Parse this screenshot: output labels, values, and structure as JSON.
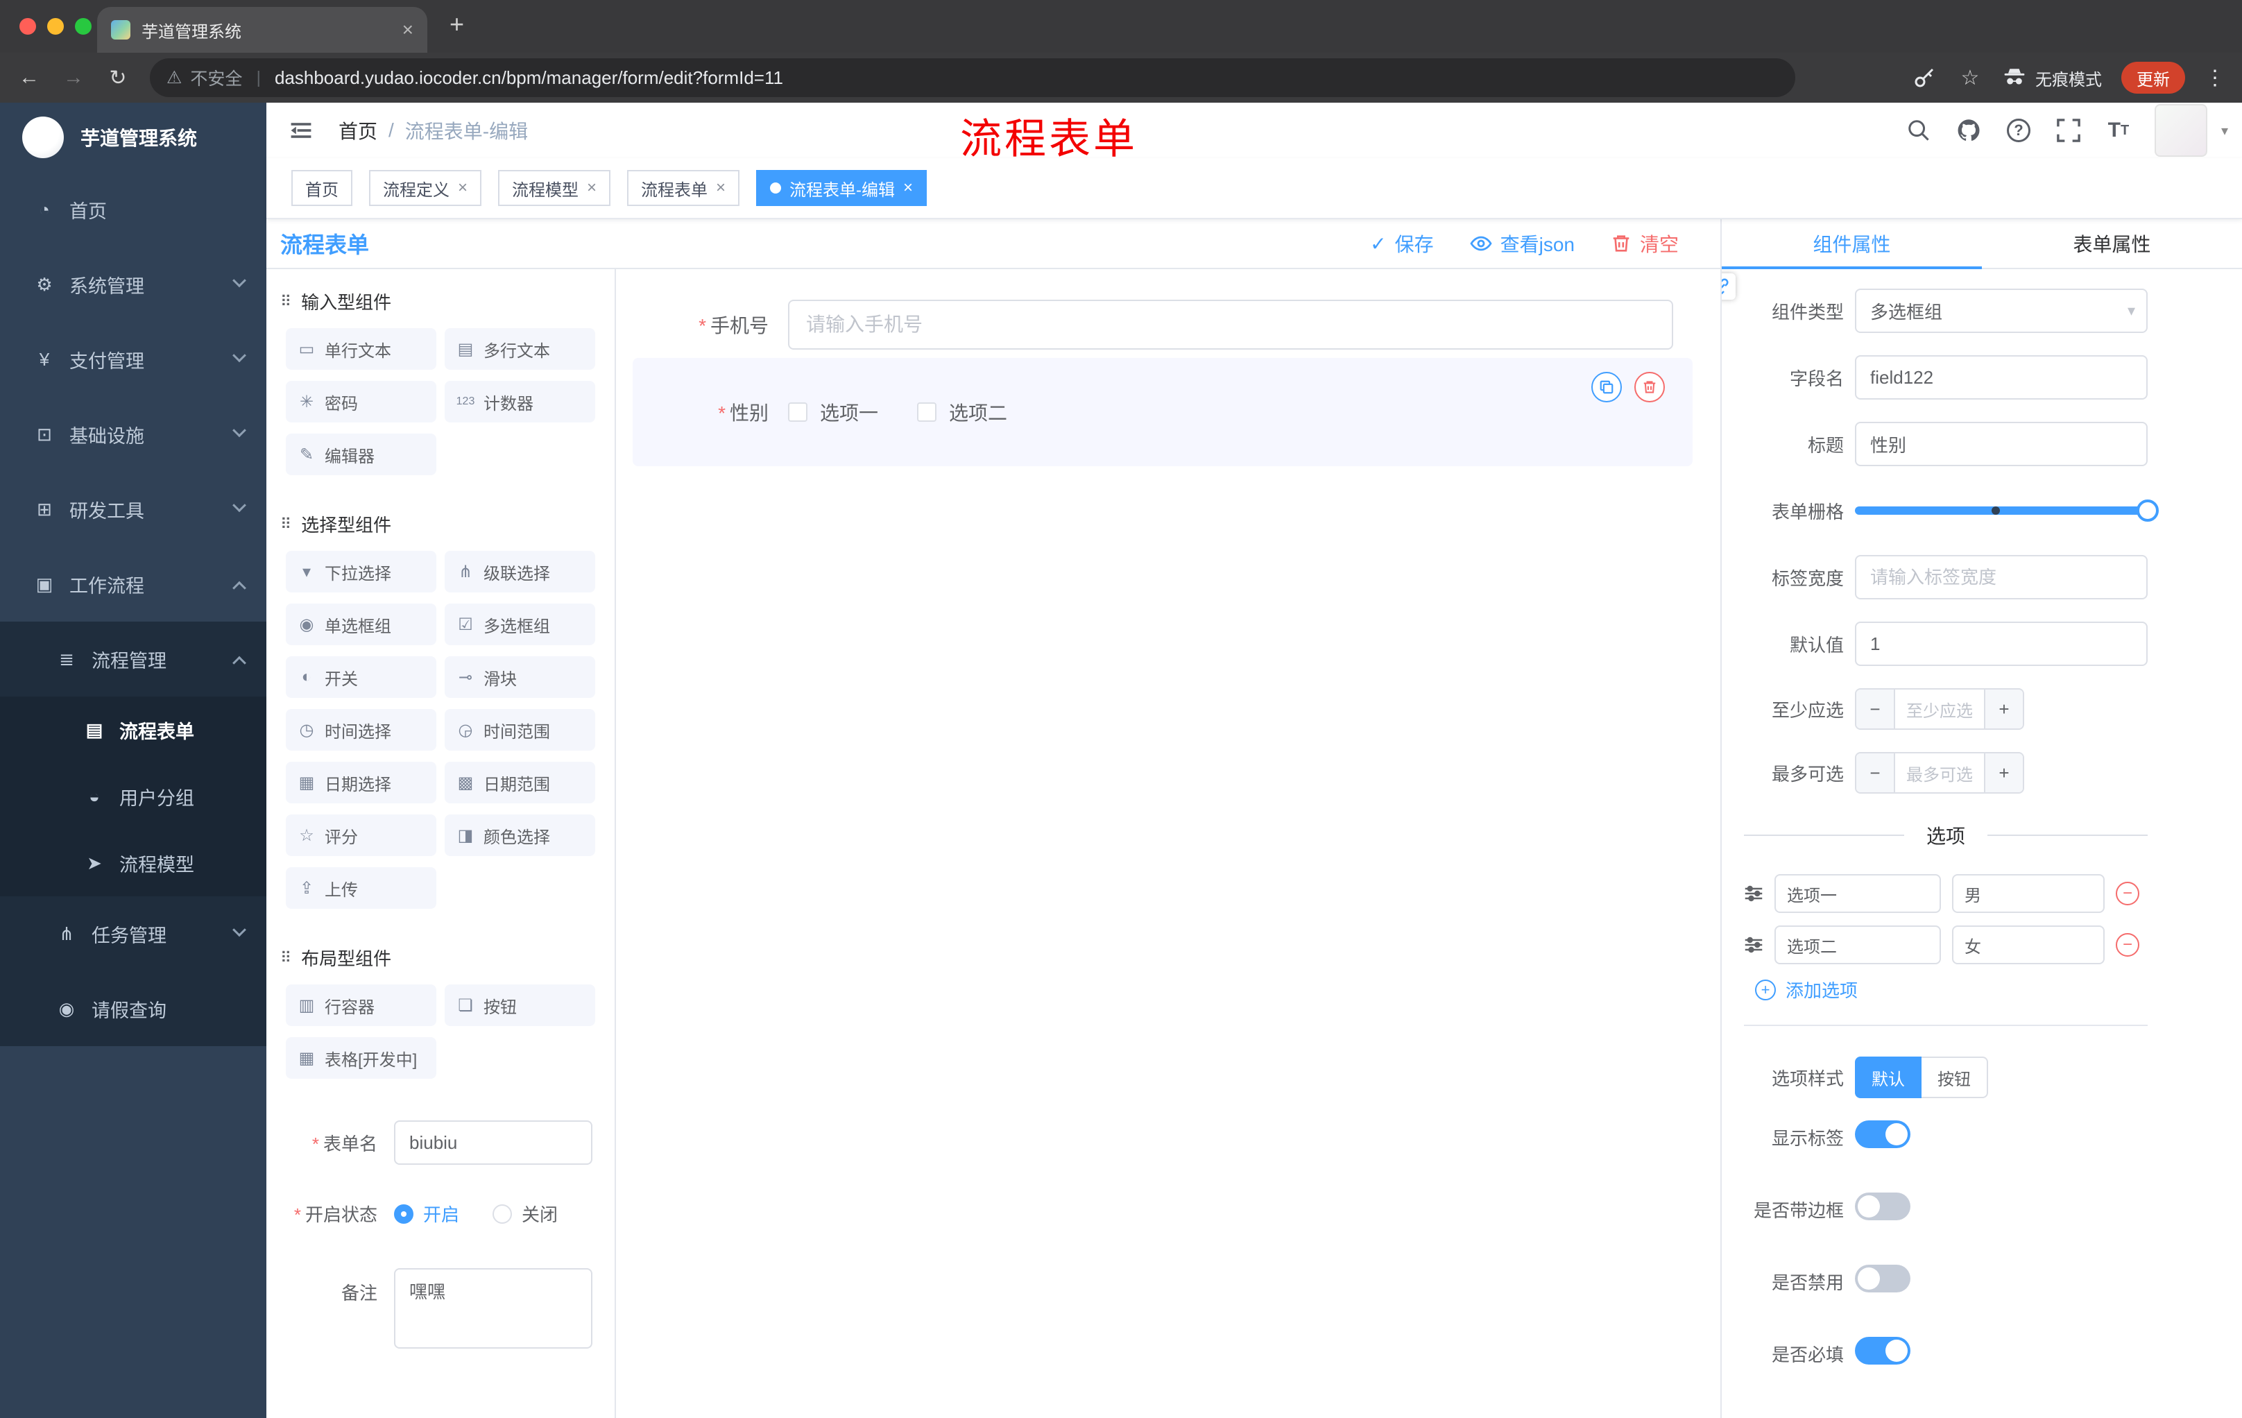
{
  "colors": {
    "accent": "#409eff",
    "danger": "#f56c6c",
    "update_badge": "#d2422b",
    "sidebar": "#304156"
  },
  "icons": {
    "close": "×",
    "new_tab": "+",
    "back": "←",
    "forward": "→",
    "reload": "↻",
    "overflow": "⋮",
    "star": "☆",
    "warning": "⚠",
    "separator": "|",
    "minus": "−",
    "plus": "+",
    "caret_down": "▾",
    "check": "✓",
    "breadcrumb_sep": "/",
    "palette_section": "⠿",
    "tab_close": "×"
  },
  "browser": {
    "tab_title": "芋道管理系统",
    "security_label": "不安全",
    "url": "dashboard.yudao.iocoder.cn/bpm/manager/form/edit?formId=11",
    "incognito_label": "无痕模式",
    "update_label": "更新"
  },
  "sidebar": {
    "brand": "芋道管理系统",
    "items": [
      {
        "icon": "◔",
        "label": "首页"
      },
      {
        "icon": "⚙",
        "label": "系统管理"
      },
      {
        "icon": "¥",
        "label": "支付管理"
      },
      {
        "icon": "⊡",
        "label": "基础设施"
      },
      {
        "icon": "⊞",
        "label": "研发工具"
      },
      {
        "icon": "▣",
        "label": "工作流程"
      },
      {
        "icon": "≣",
        "label": "流程管理"
      },
      {
        "icon": "▤",
        "label": "流程表单"
      },
      {
        "icon": "◒",
        "label": "用户分组"
      },
      {
        "icon": "➤",
        "label": "流程模型"
      },
      {
        "icon": "⋔",
        "label": "任务管理"
      },
      {
        "icon": "◉",
        "label": "请假查询"
      }
    ]
  },
  "header": {
    "breadcrumb_home": "首页",
    "breadcrumb_current": "流程表单-编辑",
    "annotation": "流程表单"
  },
  "tags": [
    {
      "label": "首页"
    },
    {
      "label": "流程定义"
    },
    {
      "label": "流程模型"
    },
    {
      "label": "流程表单"
    },
    {
      "label": "流程表单-编辑"
    }
  ],
  "designer": {
    "title": "流程表单",
    "actions": {
      "save": "保存",
      "view_json": "查看json",
      "clear": "清空"
    },
    "palette": [
      {
        "section": "输入型组件",
        "items": [
          {
            "icon": "▭",
            "label": "单行文本"
          },
          {
            "icon": "▤",
            "label": "多行文本"
          },
          {
            "icon": "✳",
            "label": "密码"
          },
          {
            "icon": "123",
            "label": "计数器"
          },
          {
            "icon": "✎",
            "label": "编辑器"
          }
        ]
      },
      {
        "section": "选择型组件",
        "items": [
          {
            "icon": "▾",
            "label": "下拉选择"
          },
          {
            "icon": "⋔",
            "label": "级联选择"
          },
          {
            "icon": "◉",
            "label": "单选框组"
          },
          {
            "icon": "☑",
            "label": "多选框组"
          },
          {
            "icon": "◐",
            "label": "开关"
          },
          {
            "icon": "⊸",
            "label": "滑块"
          },
          {
            "icon": "◷",
            "label": "时间选择"
          },
          {
            "icon": "◶",
            "label": "时间范围"
          },
          {
            "icon": "▦",
            "label": "日期选择"
          },
          {
            "icon": "▩",
            "label": "日期范围"
          },
          {
            "icon": "☆",
            "label": "评分"
          },
          {
            "icon": "◨",
            "label": "颜色选择"
          },
          {
            "icon": "⇪",
            "label": "上传"
          }
        ]
      },
      {
        "section": "布局型组件",
        "items": [
          {
            "icon": "▥",
            "label": "行容器"
          },
          {
            "icon": "❏",
            "label": "按钮"
          },
          {
            "icon": "▦",
            "label": "表格[开发中]"
          }
        ]
      }
    ],
    "meta": {
      "form_name_label": "表单名",
      "form_name_value": "biubiu",
      "status_label": "开启状态",
      "status_on": "开启",
      "status_off": "关闭",
      "remark_label": "备注",
      "remark_value": "嘿嘿"
    }
  },
  "canvas": {
    "phone": {
      "label": "手机号",
      "placeholder": "请输入手机号"
    },
    "gender": {
      "label": "性别",
      "option1": "选项一",
      "option2": "选项二"
    }
  },
  "panel": {
    "tab_component": "组件属性",
    "tab_form": "表单属性",
    "fields": {
      "type_label": "组件类型",
      "type_value": "多选框组",
      "field_label": "字段名",
      "field_value": "field122",
      "title_label": "标题",
      "title_value": "性别",
      "grid_label": "表单栅格",
      "label_width_label": "标签宽度",
      "label_width_placeholder": "请输入标签宽度",
      "default_label": "默认值",
      "default_value": "1",
      "min_label": "至少应选",
      "min_placeholder": "至少应选",
      "max_label": "最多可选",
      "max_placeholder": "最多可选"
    },
    "options_divider": "选项",
    "options": [
      {
        "label": "选项一",
        "value": "男"
      },
      {
        "label": "选项二",
        "value": "女"
      }
    ],
    "add_option": "添加选项",
    "style_label": "选项样式",
    "style_default": "默认",
    "style_button": "按钮",
    "toggles": [
      {
        "label": "显示标签"
      },
      {
        "label": "是否带边框"
      },
      {
        "label": "是否禁用"
      },
      {
        "label": "是否必填"
      }
    ]
  }
}
